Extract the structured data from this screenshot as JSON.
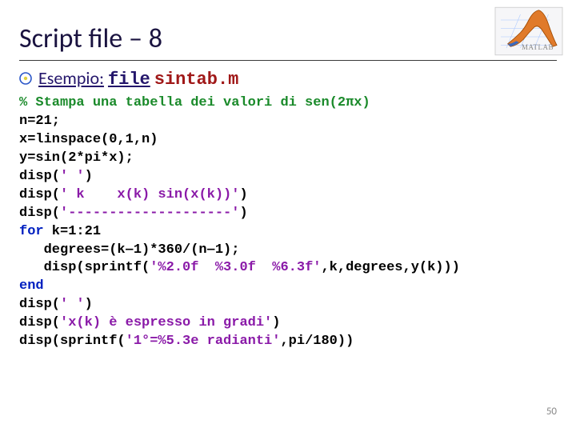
{
  "title": "Script file ‒ 8",
  "logo_caption": "MATLAB",
  "intro": {
    "label_esempio": "Esempio:",
    "label_file": "file",
    "filename": "sintab.m"
  },
  "code": {
    "comment": "% Stampa una tabella dei valori di sen(2πx)",
    "l1": "n=21;",
    "l2": "x=linspace(0,1,n)",
    "l3": "y=sin(2*pi*x);",
    "l4a": "disp(",
    "l4s": "' '",
    "l4b": ")",
    "l5a": "disp(",
    "l5s": "' k    x(k) sin(x(k))'",
    "l5b": ")",
    "l6a": "disp(",
    "l6s": "'--------------------'",
    "l6b": ")",
    "l7a": "for",
    "l7b": " k=1:21",
    "l8": "   degrees=(k‒1)*360/(n‒1);",
    "l9a": "   disp(sprintf(",
    "l9s": "'%2.0f  %3.0f  %6.3f'",
    "l9b": ",k,degrees,y(k)))",
    "l10": "end",
    "l11a": "disp(",
    "l11s": "' '",
    "l11b": ")",
    "l12a": "disp(",
    "l12s": "'x(k) è espresso in gradi'",
    "l12b": ")",
    "l13a": "disp(sprintf(",
    "l13s": "'1°=%5.3e radianti'",
    "l13b": ",pi/180))"
  },
  "page_number": "50"
}
